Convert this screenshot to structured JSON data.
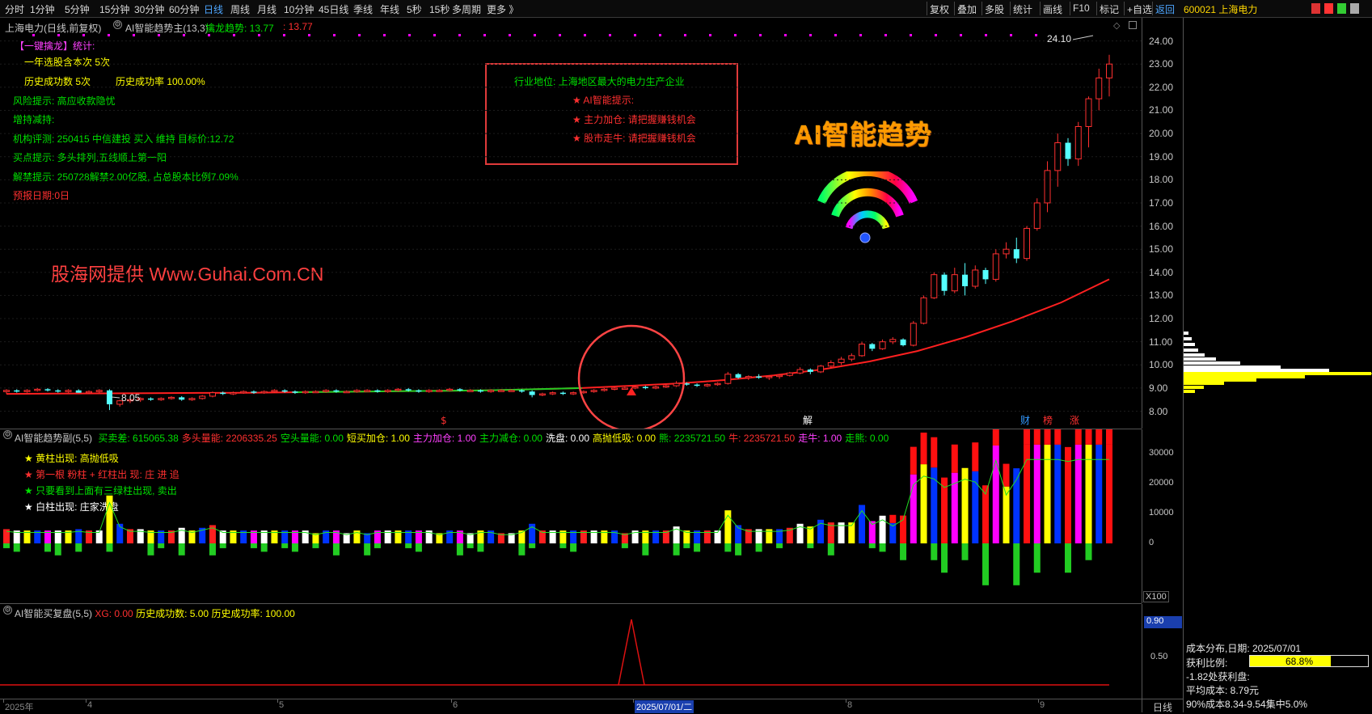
{
  "toolbar": {
    "periods": [
      "分时",
      "1分钟",
      "5分钟",
      "15分钟",
      "30分钟",
      "60分钟",
      "日线",
      "周线",
      "月线",
      "10分钟",
      "45日线",
      "季线",
      "年线",
      "5秒",
      "15秒",
      "多周期",
      "更多 》"
    ],
    "active_period": "日线",
    "right_buttons": [
      "复权",
      "叠加",
      "多股",
      "统计",
      "画线",
      "F10",
      "标记",
      "+自选",
      "返回"
    ],
    "stock_code_name": "600021 上海电力"
  },
  "main_panel": {
    "title": "上海电力(日线,前复权)",
    "indicator": "AI智能趋势主(13,3)",
    "indicator_value_label": "擒龙趋势: 13.77",
    "indicator_value2": ": 13.77",
    "stats_header": "【一键擒龙】统计:",
    "stats_lines": [
      {
        "text": "一年选股含本次 5次",
        "color": "yellow"
      },
      {
        "text": "历史成功数 5次",
        "color": "yellow"
      },
      {
        "text": "历史成功率 100.00%",
        "color": "yellow"
      }
    ],
    "info_lines": [
      {
        "text": "风险提示: 高应收款隐忧",
        "color": "green"
      },
      {
        "text": "增持减持:",
        "color": "green"
      },
      {
        "text": "机构评测: 250415 中信建投 买入 维持 目标价:12.72",
        "color": "green"
      },
      {
        "text": "买点提示: 多头排列,五线顺上第一阳",
        "color": "green"
      },
      {
        "text": "解禁提示: 250728解禁2.00亿股, 占总股本比例7.09%",
        "color": "green"
      },
      {
        "text": "预报日期:0日",
        "color": "red"
      }
    ],
    "box_lines": [
      {
        "text": "行业地位: 上海地区最大的电力生产企业",
        "color": "green"
      },
      {
        "text": "★ AI智能提示:",
        "color": "red"
      },
      {
        "text": "★ 主力加仓: 请把握赚钱机会",
        "color": "red"
      },
      {
        "text": "★ 股市走牛: 请把握赚钱机会",
        "color": "red"
      }
    ],
    "ai_title": "AI智能趋势",
    "watermark": "股海网提供 Www.Guhai.Com.CN",
    "high_label": "24.10",
    "low_label": "8.05",
    "markers": [
      "$",
      "解",
      "财",
      "榜",
      "涨"
    ],
    "price_ticks": [
      "24.00",
      "23.00",
      "22.00",
      "21.00",
      "20.00",
      "19.00",
      "18.00",
      "17.00",
      "16.00",
      "15.00",
      "14.00",
      "13.00",
      "12.00",
      "11.00",
      "10.00",
      "9.00",
      "8.00"
    ]
  },
  "sub_panel1": {
    "title": "AI智能趋势副(5,5)",
    "values": [
      {
        "text": "买卖差: 615065.38",
        "color": "green"
      },
      {
        "text": "多头量能: 2206335.25",
        "color": "red"
      },
      {
        "text": "空头量能: 0.00",
        "color": "green"
      },
      {
        "text": "短买加仓: 1.00",
        "color": "yellow"
      },
      {
        "text": "主力加仓: 1.00",
        "color": "magenta"
      },
      {
        "text": "主力减仓: 0.00",
        "color": "green"
      },
      {
        "text": "洗盘: 0.00",
        "color": "white"
      },
      {
        "text": "高抛低吸: 0.00",
        "color": "yellow"
      },
      {
        "text": "熊: 2235721.50",
        "color": "green"
      },
      {
        "text": "牛: 2235721.50",
        "color": "red"
      },
      {
        "text": "走牛: 1.00",
        "color": "magenta"
      },
      {
        "text": "走熊: 0.00",
        "color": "green"
      }
    ],
    "legend": [
      {
        "star": "★",
        "text": "黄柱出现: 高抛低吸",
        "star_color": "yellow",
        "color": "yellow"
      },
      {
        "star": "★",
        "text": "第一根 粉柱 + 红柱出 现: 庄 进 追",
        "star_color": "red",
        "color": "red"
      },
      {
        "star": "★",
        "text": "只要看到上面有三绿柱出现, 卖出",
        "star_color": "green",
        "color": "green"
      },
      {
        "star": "★",
        "text": "白柱出现: 庄家洗盘",
        "star_color": "white",
        "color": "white"
      }
    ],
    "ticks": [
      "30000",
      "20000",
      "10000",
      "0"
    ],
    "scale": "X100"
  },
  "sub_panel2": {
    "title": "AI智能买复盘(5,5)",
    "xg": "XG: 0.00",
    "success_count": "历史成功数: 5.00",
    "success_rate": "历史成功率: 100.00",
    "value_box": "0.90",
    "tick": "0.50"
  },
  "bottom_axis": {
    "labels": [
      "2025年",
      "4",
      "5",
      "6",
      "2025/07/01/二",
      "8",
      "9"
    ],
    "period": "日线"
  },
  "cost_panel": {
    "date_line": "成本分布,日期: 2025/07/01",
    "profit_label": "获利比例:",
    "profit_value": "68.8%",
    "profit_fraction": 0.688,
    "profit_disc": "-1.82处获利盘:",
    "avg_cost": "平均成本: 8.79元",
    "concentration": "90%成本8.34-9.54集中5.0%"
  },
  "chart_data": {
    "type": "candlestick",
    "ylim": [
      7.6,
      24.3
    ],
    "candles": [
      [
        8.85,
        8.95,
        8.75,
        8.9
      ],
      [
        8.9,
        8.95,
        8.8,
        8.85
      ],
      [
        8.85,
        8.95,
        8.8,
        8.9
      ],
      [
        8.9,
        9.0,
        8.85,
        8.95
      ],
      [
        8.95,
        9.0,
        8.85,
        8.9
      ],
      [
        8.9,
        8.95,
        8.8,
        8.85
      ],
      [
        8.85,
        8.95,
        8.8,
        8.9
      ],
      [
        8.9,
        8.95,
        8.8,
        8.8
      ],
      [
        8.8,
        8.9,
        8.75,
        8.85
      ],
      [
        8.85,
        8.95,
        8.8,
        8.9
      ],
      [
        8.9,
        8.95,
        8.05,
        8.3
      ],
      [
        8.3,
        8.5,
        8.2,
        8.45
      ],
      [
        8.45,
        8.55,
        8.35,
        8.5
      ],
      [
        8.5,
        8.6,
        8.4,
        8.55
      ],
      [
        8.55,
        8.6,
        8.45,
        8.5
      ],
      [
        8.5,
        8.6,
        8.45,
        8.55
      ],
      [
        8.55,
        8.65,
        8.5,
        8.6
      ],
      [
        8.6,
        8.65,
        8.45,
        8.5
      ],
      [
        8.5,
        8.6,
        8.45,
        8.55
      ],
      [
        8.55,
        8.7,
        8.5,
        8.65
      ],
      [
        8.65,
        8.85,
        8.6,
        8.8
      ],
      [
        8.8,
        8.85,
        8.7,
        8.75
      ],
      [
        8.75,
        8.85,
        8.7,
        8.8
      ],
      [
        8.8,
        8.9,
        8.75,
        8.85
      ],
      [
        8.85,
        8.9,
        8.75,
        8.8
      ],
      [
        8.8,
        8.9,
        8.75,
        8.85
      ],
      [
        8.85,
        8.95,
        8.8,
        8.9
      ],
      [
        8.9,
        8.95,
        8.8,
        8.85
      ],
      [
        8.85,
        8.9,
        8.75,
        8.8
      ],
      [
        8.8,
        8.9,
        8.75,
        8.85
      ],
      [
        8.85,
        8.9,
        8.8,
        8.85
      ],
      [
        8.85,
        8.95,
        8.8,
        8.9
      ],
      [
        8.9,
        8.95,
        8.8,
        8.85
      ],
      [
        8.85,
        8.9,
        8.8,
        8.85
      ],
      [
        8.85,
        8.95,
        8.8,
        8.9
      ],
      [
        8.9,
        8.95,
        8.85,
        8.9
      ],
      [
        8.9,
        8.95,
        8.8,
        8.85
      ],
      [
        8.85,
        8.95,
        8.8,
        8.9
      ],
      [
        8.9,
        9.0,
        8.85,
        8.95
      ],
      [
        8.95,
        9.0,
        8.85,
        8.9
      ],
      [
        8.9,
        8.95,
        8.8,
        8.85
      ],
      [
        8.85,
        8.95,
        8.8,
        8.9
      ],
      [
        8.9,
        8.95,
        8.85,
        8.9
      ],
      [
        8.9,
        9.0,
        8.85,
        8.95
      ],
      [
        8.95,
        9.0,
        8.85,
        8.9
      ],
      [
        8.9,
        8.95,
        8.85,
        8.9
      ],
      [
        8.9,
        8.95,
        8.8,
        8.85
      ],
      [
        8.85,
        8.95,
        8.8,
        8.9
      ],
      [
        8.9,
        8.95,
        8.85,
        8.9
      ],
      [
        8.9,
        8.95,
        8.85,
        8.9
      ],
      [
        8.9,
        8.95,
        8.8,
        8.85
      ],
      [
        8.85,
        8.9,
        8.6,
        8.7
      ],
      [
        8.7,
        8.8,
        8.65,
        8.75
      ],
      [
        8.75,
        8.85,
        8.7,
        8.8
      ],
      [
        8.8,
        8.85,
        8.7,
        8.75
      ],
      [
        8.75,
        8.85,
        8.7,
        8.8
      ],
      [
        8.8,
        8.9,
        8.75,
        8.85
      ],
      [
        8.85,
        8.95,
        8.8,
        8.9
      ],
      [
        8.9,
        9.0,
        8.85,
        8.95
      ],
      [
        8.95,
        9.05,
        8.9,
        9.0
      ],
      [
        9.0,
        9.05,
        8.95,
        9.0
      ],
      [
        9.0,
        9.1,
        8.95,
        9.05
      ],
      [
        9.05,
        9.1,
        8.95,
        9.0
      ],
      [
        9.0,
        9.1,
        8.95,
        9.05
      ],
      [
        9.05,
        9.15,
        9.0,
        9.1
      ],
      [
        9.1,
        9.3,
        9.05,
        9.2
      ],
      [
        9.2,
        9.25,
        9.1,
        9.15
      ],
      [
        9.15,
        9.2,
        9.05,
        9.1
      ],
      [
        9.1,
        9.2,
        9.05,
        9.15
      ],
      [
        9.15,
        9.25,
        9.1,
        9.2
      ],
      [
        9.2,
        9.7,
        9.15,
        9.6
      ],
      [
        9.6,
        9.65,
        9.4,
        9.45
      ],
      [
        9.45,
        9.55,
        9.35,
        9.5
      ],
      [
        9.5,
        9.6,
        9.4,
        9.45
      ],
      [
        9.45,
        9.55,
        9.35,
        9.5
      ],
      [
        9.5,
        9.6,
        9.4,
        9.55
      ],
      [
        9.55,
        9.7,
        9.5,
        9.65
      ],
      [
        9.65,
        9.9,
        9.6,
        9.8
      ],
      [
        9.8,
        9.85,
        9.6,
        9.7
      ],
      [
        9.7,
        10.0,
        9.65,
        9.95
      ],
      [
        9.95,
        10.2,
        9.85,
        10.1
      ],
      [
        10.1,
        10.35,
        10.0,
        10.25
      ],
      [
        10.25,
        10.5,
        10.15,
        10.4
      ],
      [
        10.4,
        11.0,
        10.35,
        10.9
      ],
      [
        10.9,
        10.95,
        10.6,
        10.7
      ],
      [
        10.7,
        11.1,
        10.65,
        11.0
      ],
      [
        11.0,
        11.2,
        10.9,
        11.1
      ],
      [
        11.1,
        11.15,
        10.8,
        10.85
      ],
      [
        10.85,
        11.9,
        10.8,
        11.8
      ],
      [
        11.8,
        13.0,
        11.75,
        12.9
      ],
      [
        12.9,
        14.0,
        12.85,
        13.9
      ],
      [
        13.9,
        14.0,
        13.0,
        13.2
      ],
      [
        13.2,
        14.2,
        13.1,
        13.9
      ],
      [
        13.9,
        14.4,
        13.0,
        13.4
      ],
      [
        13.4,
        14.3,
        13.3,
        14.1
      ],
      [
        14.1,
        14.2,
        13.5,
        13.7
      ],
      [
        13.7,
        15.0,
        13.6,
        14.8
      ],
      [
        14.8,
        15.3,
        14.6,
        15.0
      ],
      [
        15.0,
        15.5,
        14.4,
        14.6
      ],
      [
        14.6,
        16.0,
        14.5,
        15.9
      ],
      [
        15.9,
        17.2,
        15.8,
        17.0
      ],
      [
        17.0,
        18.8,
        16.6,
        18.4
      ],
      [
        18.4,
        20.0,
        17.7,
        19.6
      ],
      [
        19.6,
        19.8,
        18.6,
        18.9
      ],
      [
        18.9,
        20.5,
        18.6,
        20.3
      ],
      [
        20.3,
        21.6,
        19.4,
        21.5
      ],
      [
        21.5,
        22.8,
        21.0,
        22.4
      ],
      [
        22.4,
        23.4,
        21.6,
        23.0
      ]
    ],
    "ma_trend": [
      8.75,
      8.76,
      8.77,
      8.78,
      8.79,
      8.8,
      8.82,
      8.84,
      8.86,
      8.88,
      8.9,
      8.95,
      9.0,
      9.1,
      9.2,
      9.35,
      9.55,
      9.8,
      10.15,
      10.6,
      11.2,
      11.9,
      12.7,
      13.7
    ]
  }
}
